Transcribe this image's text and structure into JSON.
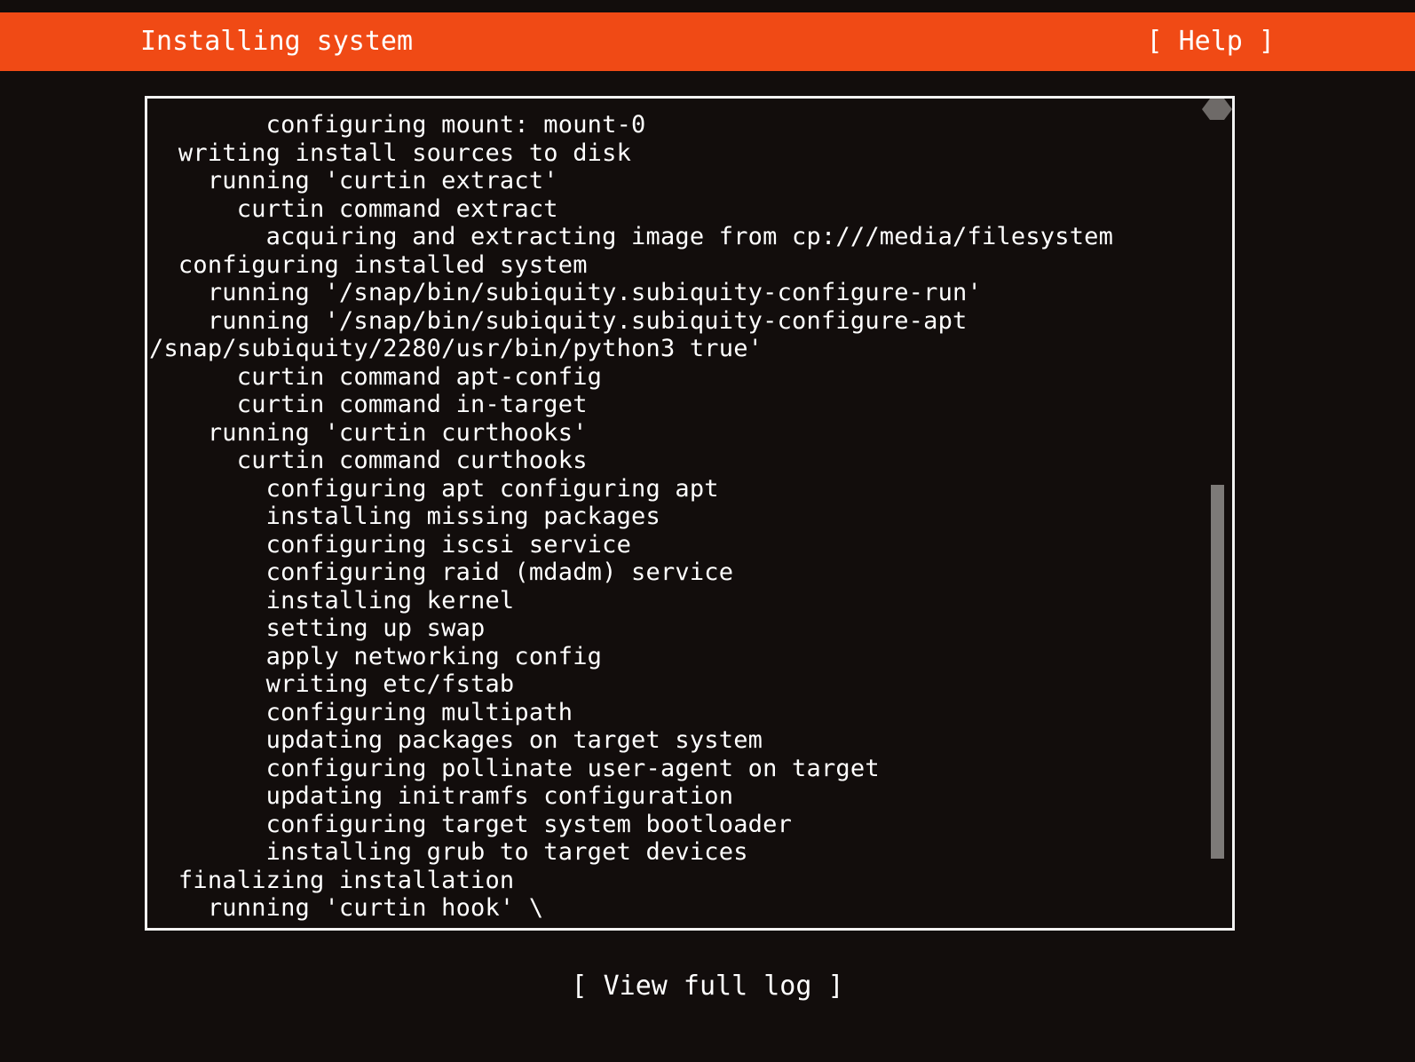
{
  "header": {
    "title": "Installing system",
    "help_label": "[ Help ]",
    "background_color": "#f04a15",
    "text_color": "#ffffff"
  },
  "log_panel": {
    "border_color": "#f2f2f2",
    "background_color": "#120d0c",
    "text_color": "#ffffff",
    "lines": [
      "        configuring mount: mount-0",
      "  writing install sources to disk",
      "    running 'curtin extract'",
      "      curtin command extract",
      "        acquiring and extracting image from cp:///media/filesystem",
      "  configuring installed system",
      "    running '/snap/bin/subiquity.subiquity-configure-run'",
      "    running '/snap/bin/subiquity.subiquity-configure-apt",
      "/snap/subiquity/2280/usr/bin/python3 true'",
      "      curtin command apt-config",
      "      curtin command in-target",
      "    running 'curtin curthooks'",
      "      curtin command curthooks",
      "        configuring apt configuring apt",
      "        installing missing packages",
      "        configuring iscsi service",
      "        configuring raid (mdadm) service",
      "        installing kernel",
      "        setting up swap",
      "        apply networking config",
      "        writing etc/fstab",
      "        configuring multipath",
      "        updating packages on target system",
      "        configuring pollinate user-agent on target",
      "        updating initramfs configuration",
      "        configuring target system bootloader",
      "        installing grub to target devices",
      "  finalizing installation",
      "    running 'curtin hook' \\"
    ]
  },
  "scrollbar": {
    "up_arrow_icon": "triangle-up-icon",
    "down_arrow_icon": "triangle-down-icon",
    "thumb_top_percent": 46,
    "thumb_height_percent": 50,
    "thumb_color": "#7d7a78",
    "arrow_color": "#6e6a68"
  },
  "footer": {
    "view_full_log_label": "[ View full log ]"
  }
}
